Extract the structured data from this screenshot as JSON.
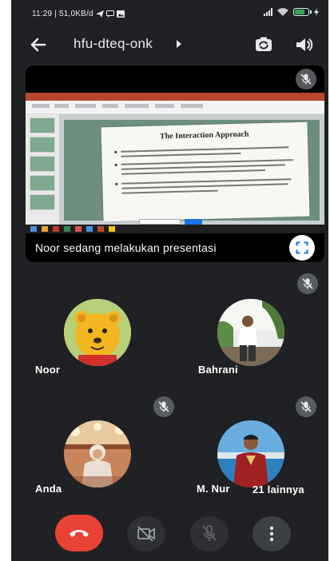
{
  "status_bar": {
    "time_and_speed": "11:29 | 51,0KB/d",
    "battery_color": "#34a853"
  },
  "app_bar": {
    "meeting_code": "hfu-dteq-onk",
    "icons": [
      "back-arrow-icon",
      "switch-camera-icon",
      "speaker-icon"
    ]
  },
  "presentation": {
    "slide_title": "The Interaction Approach",
    "caption": "Noor sedang melakukan presentasi",
    "presenter_mic": "muted"
  },
  "participants": [
    {
      "name": "Noor",
      "mic": "on"
    },
    {
      "name": "Bahrani",
      "mic": "muted"
    },
    {
      "name": "Anda",
      "mic": "muted"
    },
    {
      "name": "M. Nur",
      "mic": "muted"
    }
  ],
  "others_label": "21 lainnya",
  "controls": {
    "end_call_color": "#ea4335",
    "items": [
      "end-call-icon",
      "camera-off-icon",
      "mic-off-icon",
      "more-options-icon"
    ]
  }
}
